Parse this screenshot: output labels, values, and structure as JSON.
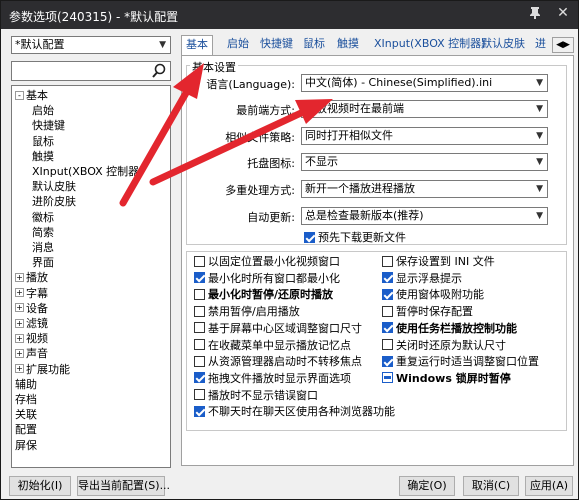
{
  "window": {
    "title": "参数选项(240315) - *默认配置"
  },
  "left": {
    "profile_select": "*默认配置",
    "search_placeholder": "",
    "tree": [
      {
        "label": "基本",
        "expander": "-",
        "indent": 0
      },
      {
        "label": "启始",
        "indent": 1
      },
      {
        "label": "快捷键",
        "indent": 1
      },
      {
        "label": "鼠标",
        "indent": 1
      },
      {
        "label": "触摸",
        "indent": 1
      },
      {
        "label": "XInput(XBOX 控制器)",
        "indent": 1
      },
      {
        "label": "默认皮肤",
        "indent": 1
      },
      {
        "label": "进阶皮肤",
        "indent": 1
      },
      {
        "label": "徽标",
        "indent": 1
      },
      {
        "label": "简索",
        "indent": 1
      },
      {
        "label": "消息",
        "indent": 1
      },
      {
        "label": "界面",
        "indent": 1
      },
      {
        "label": "播放",
        "expander": "+",
        "indent": 0
      },
      {
        "label": "字幕",
        "expander": "+",
        "indent": 0
      },
      {
        "label": "设备",
        "expander": "+",
        "indent": 0
      },
      {
        "label": "滤镜",
        "expander": "+",
        "indent": 0
      },
      {
        "label": "视频",
        "expander": "+",
        "indent": 0
      },
      {
        "label": "声音",
        "expander": "+",
        "indent": 0
      },
      {
        "label": "扩展功能",
        "expander": "+",
        "indent": 0
      },
      {
        "label": "辅助",
        "indent": 0
      },
      {
        "label": "存档",
        "indent": 0
      },
      {
        "label": "关联",
        "indent": 0
      },
      {
        "label": "配置",
        "indent": 0
      },
      {
        "label": "屏保",
        "indent": 0
      }
    ]
  },
  "tabs": [
    "基本",
    "启始",
    "快捷键",
    "鼠标",
    "触摸",
    "XInput(XBOX 控制器)",
    "默认皮肤",
    "进"
  ],
  "group_title": "基本设置",
  "fields": [
    {
      "label": "语言(Language):",
      "value": "中文(简体) - Chinese(Simplified).ini"
    },
    {
      "label": "最前端方式:",
      "value": "播放视频时在最前端"
    },
    {
      "label": "相似文件策略:",
      "value": "同时打开相似文件"
    },
    {
      "label": "托盘图标:",
      "value": "不显示"
    },
    {
      "label": "多重处理方式:",
      "value": "新开一个播放进程播放"
    },
    {
      "label": "自动更新:",
      "value": "总是检查最新版本(推荐)"
    }
  ],
  "predownload": "预先下载更新文件",
  "options_left": [
    {
      "label": "以固定位置最小化视频窗口",
      "state": "off",
      "bold": false
    },
    {
      "label": "最小化时所有窗口都最小化",
      "state": "on",
      "bold": false
    },
    {
      "label": "最小化时暂停/还原时播放",
      "state": "off",
      "bold": true
    },
    {
      "label": "禁用暂停/启用播放",
      "state": "off",
      "bold": false
    },
    {
      "label": "基于屏幕中心区域调整窗口尺寸",
      "state": "off",
      "bold": false
    },
    {
      "label": "在收藏菜单中显示播放记忆点",
      "state": "off",
      "bold": false
    },
    {
      "label": "从资源管理器启动时不转移焦点",
      "state": "off",
      "bold": false
    },
    {
      "label": "拖拽文件播放时显示界面选项",
      "state": "on",
      "bold": false
    },
    {
      "label": "播放时不显示错误窗口",
      "state": "off",
      "bold": false
    },
    {
      "label": "不聊天时在聊天区使用各种浏览器功能",
      "state": "on",
      "bold": false
    }
  ],
  "options_right": [
    {
      "label": "保存设置到 INI 文件",
      "state": "off",
      "bold": false
    },
    {
      "label": "显示浮悬提示",
      "state": "on",
      "bold": false
    },
    {
      "label": "使用窗体吸附功能",
      "state": "on",
      "bold": false
    },
    {
      "label": "暂停时保存配置",
      "state": "off",
      "bold": false
    },
    {
      "label": "使用任务栏播放控制功能",
      "state": "on",
      "bold": true
    },
    {
      "label": "关闭时还原为默认尺寸",
      "state": "off",
      "bold": false
    },
    {
      "label": "重复运行时适当调整窗口位置",
      "state": "on",
      "bold": false
    },
    {
      "label": "Windows 锁屏时暂停",
      "state": "partial",
      "bold": true
    }
  ],
  "buttons": {
    "init": "初始化(I)",
    "export": "导出当前配置(S)...",
    "ok": "确定(O)",
    "cancel": "取消(C)",
    "apply": "应用(A)"
  },
  "colors": {
    "titlebar": "#2d2d30",
    "accent": "#1a5dc9",
    "arrow": "#e3262e",
    "tab_text": "#1a4f9c"
  }
}
